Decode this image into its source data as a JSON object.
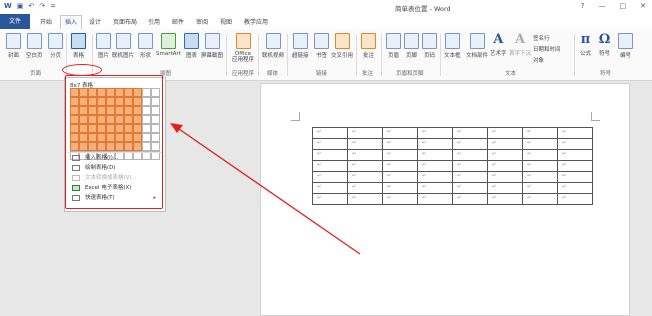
{
  "titlebar": {
    "title": "简单表位置 - Word",
    "qat": [
      "W",
      "▣",
      "↶",
      "↷",
      "="
    ],
    "window_controls": [
      "?",
      "—",
      "□",
      "✕"
    ]
  },
  "tabs": {
    "file": "文件",
    "items": [
      "开始",
      "插入",
      "设计",
      "页面布局",
      "引用",
      "邮件",
      "审阅",
      "视图",
      "教学应用"
    ],
    "active": "插入"
  },
  "ribbon": {
    "buttons": [
      {
        "label": "封面",
        "icon": "cover-page-icon"
      },
      {
        "label": "空白页",
        "icon": "blank-page-icon"
      },
      {
        "label": "分页",
        "icon": "page-break-icon"
      },
      {
        "label": "表格",
        "icon": "table-icon"
      },
      {
        "label": "图片",
        "icon": "picture-icon"
      },
      {
        "label": "联机图片",
        "icon": "online-picture-icon"
      },
      {
        "label": "形状",
        "icon": "shapes-icon"
      },
      {
        "label": "SmartArt",
        "icon": "smartart-icon"
      },
      {
        "label": "图表",
        "icon": "chart-icon"
      },
      {
        "label": "屏幕截图",
        "icon": "screenshot-icon"
      },
      {
        "label": "Office\n应用程序",
        "icon": "office-apps-icon"
      },
      {
        "label": "联机视频",
        "icon": "online-video-icon"
      },
      {
        "label": "超链接",
        "icon": "hyperlink-icon"
      },
      {
        "label": "书签",
        "icon": "bookmark-icon"
      },
      {
        "label": "交叉引用",
        "icon": "cross-reference-icon"
      },
      {
        "label": "批注",
        "icon": "comment-icon"
      },
      {
        "label": "页眉",
        "icon": "header-icon"
      },
      {
        "label": "页脚",
        "icon": "footer-icon"
      },
      {
        "label": "页码",
        "icon": "page-number-icon"
      },
      {
        "label": "文本框",
        "icon": "textbox-icon"
      },
      {
        "label": "文档部件",
        "icon": "quick-parts-icon"
      },
      {
        "label": "艺术字",
        "icon": "wordart-icon"
      },
      {
        "label": "首字下沉",
        "icon": "drop-cap-icon"
      },
      {
        "label": "公式",
        "icon": "equation-icon"
      },
      {
        "label": "符号",
        "icon": "symbol-icon"
      },
      {
        "label": "编号",
        "icon": "number-icon"
      }
    ],
    "small_items": [
      "签名行",
      "日期和时间",
      "对象"
    ],
    "groups": [
      "页面",
      "表格",
      "插图",
      "应用程序",
      "媒体",
      "链接",
      "批注",
      "页眉和页脚",
      "文本",
      "符号"
    ]
  },
  "table_dropdown": {
    "grid_label": "8x7 表格",
    "grid_cols": 10,
    "grid_rows": 8,
    "selected_cols": 8,
    "selected_rows": 7,
    "menu": [
      {
        "label": "插入表格(I)...",
        "icon": "insert-table-icon",
        "enabled": true
      },
      {
        "label": "绘制表格(D)",
        "icon": "draw-table-icon",
        "enabled": true
      },
      {
        "label": "文本转换成表格(V)...",
        "icon": "convert-text-icon",
        "enabled": false
      },
      {
        "label": "Excel 电子表格(X)",
        "icon": "excel-icon",
        "enabled": true
      },
      {
        "label": "快速表格(T)",
        "icon": "quick-tables-icon",
        "enabled": true,
        "submenu": true
      }
    ]
  },
  "document": {
    "table_rows": 7,
    "table_cols": 8,
    "cell_mark": "↵",
    "row_end_mark": "↵"
  },
  "colors": {
    "accent": "#2b579a",
    "highlight_cell": "#f7b07a",
    "annotation_red": "#e02020"
  }
}
